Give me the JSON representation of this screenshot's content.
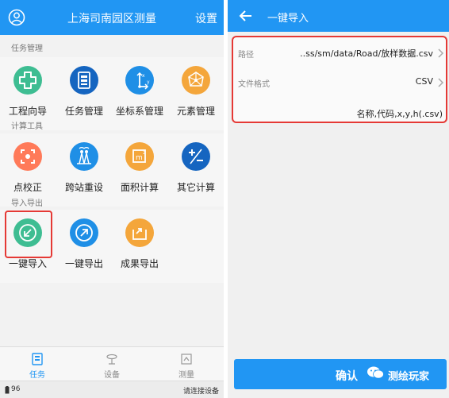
{
  "colors": {
    "primary": "#2196f3",
    "highlight": "#e53935",
    "green": "#3ebd92",
    "blue": "#1f8fe6",
    "orange": "#f4a63b",
    "navy": "#1565c0",
    "coral": "#ff7a59"
  },
  "left": {
    "header": {
      "title": "上海司南园区测量",
      "right": "设置",
      "avatar_icon": "user-circle-icon"
    },
    "sections": [
      {
        "title": "任务管理",
        "items": [
          {
            "label": "工程向导",
            "icon": "medical-cross-icon"
          },
          {
            "label": "任务管理",
            "icon": "document-list-icon"
          },
          {
            "label": "坐标系管理",
            "icon": "axis-icon"
          },
          {
            "label": "元素管理",
            "icon": "network-icon"
          }
        ]
      },
      {
        "title": "计算工具",
        "items": [
          {
            "label": "点校正",
            "icon": "target-frame-icon"
          },
          {
            "label": "跨站重设",
            "icon": "tower-icon"
          },
          {
            "label": "面积计算",
            "icon": "area-icon"
          },
          {
            "label": "其它计算",
            "icon": "calculator-icon"
          }
        ]
      },
      {
        "title": "导入导出",
        "items": [
          {
            "label": "一键导入",
            "icon": "import-arrow-icon"
          },
          {
            "label": "一键导出",
            "icon": "export-arrow-icon"
          },
          {
            "label": "成果导出",
            "icon": "result-export-icon"
          }
        ]
      }
    ],
    "bottom_nav": [
      {
        "label": "任务",
        "icon": "task-icon",
        "active": true
      },
      {
        "label": "设备",
        "icon": "device-icon",
        "active": false
      },
      {
        "label": "测量",
        "icon": "measure-icon",
        "active": false
      }
    ],
    "status": {
      "battery": "96",
      "connection": "请连接设备"
    }
  },
  "right": {
    "header": {
      "title": "一键导入",
      "back_icon": "arrow-left-icon"
    },
    "rows": [
      {
        "key": "路径",
        "value": "..ss/sm/data/Road/放样数据.csv"
      },
      {
        "key": "文件格式",
        "value": "CSV"
      }
    ],
    "hint": "名称,代码,x,y,h(.csv)",
    "confirm": "确认",
    "watermark": "测绘玩家"
  }
}
